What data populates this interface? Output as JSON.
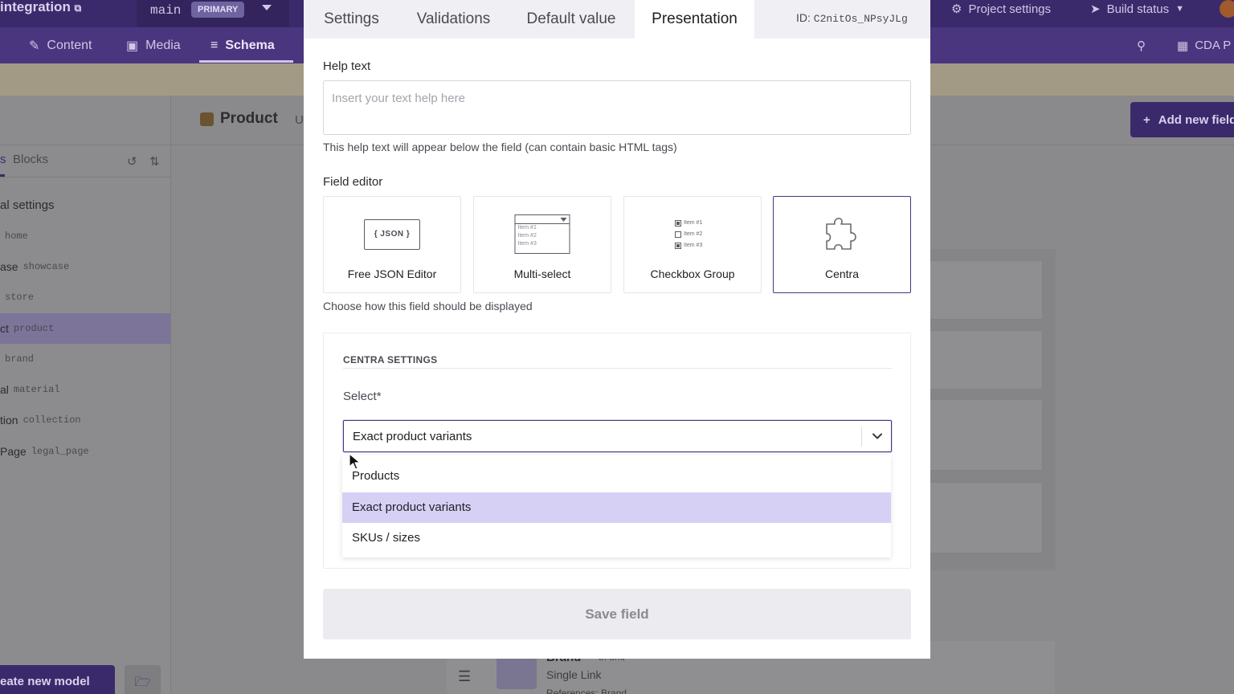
{
  "background": {
    "topbar": {
      "project": "integration",
      "branch": "main",
      "branch_badge": "PRIMARY",
      "project_settings": "Project settings",
      "build_status": "Build status"
    },
    "nav": {
      "content": "Content",
      "media": "Media",
      "schema": "Schema",
      "cda": "CDA P"
    },
    "sidebar": {
      "tab_models": "s",
      "tab_blocks": "Blocks",
      "section": "al settings",
      "items": [
        {
          "label": "",
          "api": "home"
        },
        {
          "label": "ase",
          "api": "showcase"
        },
        {
          "label": "",
          "api": "store"
        },
        {
          "label": "ct",
          "api": "product"
        },
        {
          "label": "",
          "api": "brand"
        },
        {
          "label": "al",
          "api": "material"
        },
        {
          "label": "tion",
          "api": "collection"
        },
        {
          "label": "Page",
          "api": "legal_page"
        }
      ],
      "create_button": "eate new model"
    },
    "main": {
      "model_title": "Product",
      "model_sub": "U",
      "add_field": "Add new field",
      "bottom_field": {
        "name": "Brand",
        "api": "brand",
        "type": "Single Link",
        "reference": "References: Brand"
      }
    }
  },
  "modal": {
    "tabs": [
      {
        "label": "Settings"
      },
      {
        "label": "Validations"
      },
      {
        "label": "Default value"
      },
      {
        "label": "Presentation"
      }
    ],
    "id_label": "ID: ",
    "id_value": "C2nitOs_NPsyJLg",
    "help_text": {
      "label": "Help text",
      "placeholder": "Insert your text help here",
      "value": "",
      "hint": "This help text will appear below the field (can contain basic HTML tags)"
    },
    "field_editor": {
      "label": "Field editor",
      "options": [
        {
          "name": "Free JSON Editor",
          "pic_text": "{ JSON }"
        },
        {
          "name": "Multi-select",
          "pic_items": [
            "Item #1",
            "Item #2",
            "Item #3"
          ]
        },
        {
          "name": "Checkbox Group",
          "pic_items": [
            "Item #1",
            "Item #2",
            "Item #3"
          ]
        },
        {
          "name": "Centra"
        }
      ],
      "selected": "Centra",
      "hint": "Choose how this field should be displayed"
    },
    "centra_settings": {
      "heading": "CENTRA SETTINGS",
      "select_label": "Select*",
      "selected_value": "Exact product variants",
      "options": [
        {
          "label": "Products"
        },
        {
          "label": "Exact product variants"
        },
        {
          "label": "SKUs / sizes"
        }
      ]
    },
    "save_button": "Save field"
  },
  "colors": {
    "accent": "#4a357f",
    "highlight": "#d6d0f5",
    "overlay_topbar": "#3b2a6b"
  }
}
